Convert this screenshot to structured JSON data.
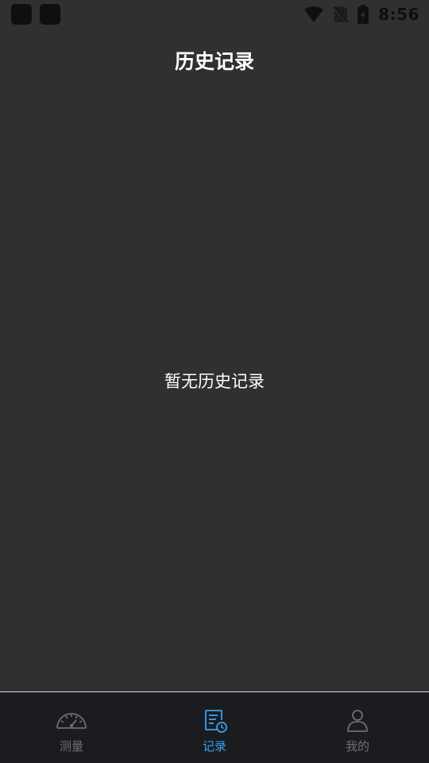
{
  "status_bar": {
    "time": "8:56",
    "icons": [
      "app-notification-icon",
      "app-notification-icon",
      "wifi-icon",
      "no-sim-icon",
      "battery-charging-icon"
    ]
  },
  "header": {
    "title": "历史记录"
  },
  "main": {
    "empty_message": "暂无历史记录"
  },
  "bottom_nav": {
    "items": [
      {
        "label": "测量",
        "icon": "speedometer-icon",
        "active": false
      },
      {
        "label": "记录",
        "icon": "record-clock-icon",
        "active": true
      },
      {
        "label": "我的",
        "icon": "person-icon",
        "active": false
      }
    ]
  },
  "colors": {
    "background": "#303030",
    "nav_background": "#1b1c20",
    "active": "#3aa0f2",
    "inactive": "#6e6f73",
    "text": "#ffffff"
  }
}
